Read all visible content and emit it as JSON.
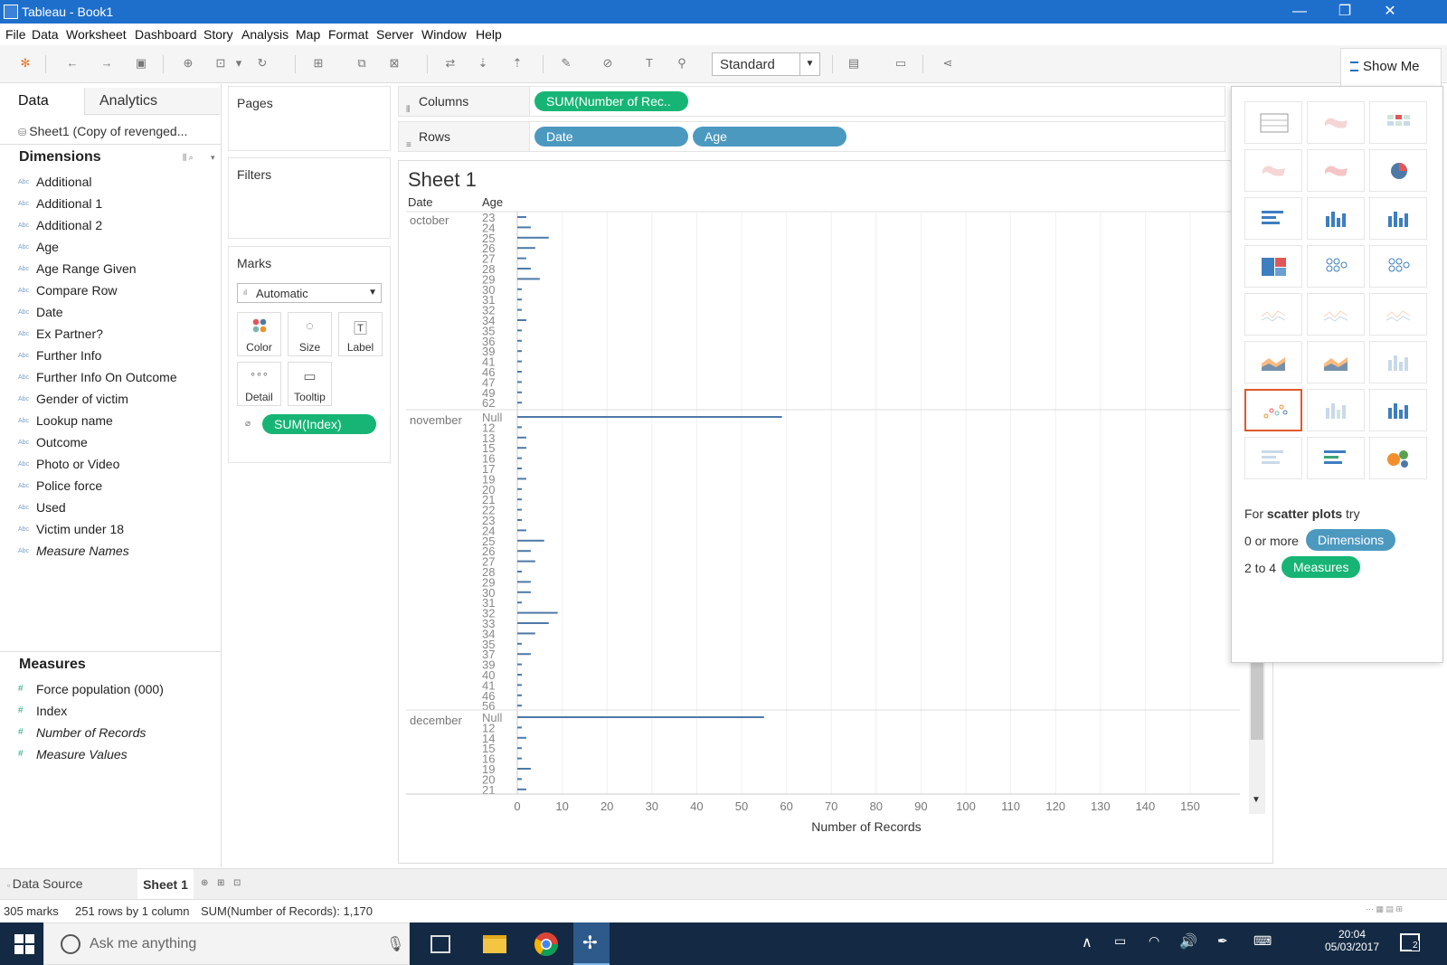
{
  "window": {
    "title": "Tableau - Book1",
    "minimize": "—",
    "restore": "❐",
    "close": "✕"
  },
  "menu": [
    "File",
    "Data",
    "Worksheet",
    "Dashboard",
    "Story",
    "Analysis",
    "Map",
    "Format",
    "Server",
    "Window",
    "Help"
  ],
  "toolbar": {
    "fit_select": "Standard",
    "show_me": "Show Me"
  },
  "data_pane": {
    "tabs": [
      "Data",
      "Analytics"
    ],
    "datasource": "Sheet1 (Copy of revenged...",
    "dimensions_title": "Dimensions",
    "dimensions": [
      "Additional",
      "Additional 1",
      "Additional 2",
      "Age",
      "Age Range Given",
      "Compare Row",
      "Date",
      "Ex Partner?",
      "Further Info",
      "Further Info On Outcome",
      "Gender of victim",
      "Lookup name",
      "Outcome",
      "Photo or Video",
      "Police force",
      "Used",
      "Victim under 18",
      "Measure Names"
    ],
    "measures_title": "Measures",
    "measures": [
      "Force population (000)",
      "Index",
      "Number of Records",
      "Measure Values"
    ]
  },
  "cards": {
    "pages": "Pages",
    "filters": "Filters",
    "marks": "Marks",
    "mark_type": "Automatic",
    "buttons": [
      "Color",
      "Size",
      "Label",
      "Detail",
      "Tooltip"
    ],
    "marks_pill": "SUM(Index)"
  },
  "shelves": {
    "columns_label": "Columns",
    "rows_label": "Rows",
    "columns_pill": "SUM(Number of Rec..",
    "rows_pills": [
      "Date",
      "Age"
    ]
  },
  "sheet": {
    "title": "Sheet 1"
  },
  "chart_data": {
    "type": "bar",
    "orientation": "horizontal",
    "row_headers": [
      "Date",
      "Age"
    ],
    "xlabel": "Number of Records",
    "xticks": [
      0,
      10,
      20,
      30,
      40,
      50,
      60,
      70,
      80,
      90,
      100,
      110,
      120,
      130,
      140,
      150
    ],
    "xlim": [
      0,
      156
    ],
    "groups": [
      {
        "date": "october",
        "ages": [
          "23",
          "24",
          "25",
          "26",
          "27",
          "28",
          "29",
          "30",
          "31",
          "32",
          "34",
          "35",
          "36",
          "39",
          "41",
          "46",
          "47",
          "49",
          "62"
        ],
        "values": [
          2,
          3,
          7,
          4,
          2,
          3,
          5,
          1,
          1,
          1,
          2,
          1,
          1,
          1,
          1,
          1,
          1,
          1,
          1
        ]
      },
      {
        "date": "november",
        "ages": [
          "Null",
          "12",
          "13",
          "15",
          "16",
          "17",
          "19",
          "20",
          "21",
          "22",
          "23",
          "24",
          "25",
          "26",
          "27",
          "28",
          "29",
          "30",
          "31",
          "32",
          "33",
          "34",
          "35",
          "37",
          "39",
          "40",
          "41",
          "46",
          "56"
        ],
        "values": [
          59,
          1,
          2,
          2,
          1,
          1,
          2,
          1,
          1,
          1,
          1,
          2,
          6,
          3,
          4,
          1,
          3,
          3,
          1,
          9,
          7,
          4,
          1,
          3,
          1,
          1,
          1,
          1,
          1
        ]
      },
      {
        "date": "december",
        "ages": [
          "Null",
          "12",
          "14",
          "15",
          "16",
          "19",
          "20",
          "21"
        ],
        "values": [
          55,
          1,
          2,
          1,
          1,
          3,
          1,
          2
        ]
      }
    ]
  },
  "show_me": {
    "hint_prefix": "For ",
    "hint_bold": "scatter plots",
    "hint_suffix": " try",
    "req1_text": "0 or more",
    "req1_pill": "Dimensions",
    "req2_text": "2 to 4",
    "req2_pill": "Measures",
    "colors": {
      "dimension": "#4c99c0",
      "measure": "#16b575",
      "selected_border": "#e0592a"
    }
  },
  "tabs": {
    "data_source": "Data Source",
    "sheet": "Sheet 1"
  },
  "status": {
    "marks": "305 marks",
    "rows": "251 rows by 1 column",
    "sum": "SUM(Number of Records): 1,170"
  },
  "taskbar": {
    "search_placeholder": "Ask me anything",
    "time": "20:04",
    "date": "05/03/2017",
    "notifications": "2"
  }
}
